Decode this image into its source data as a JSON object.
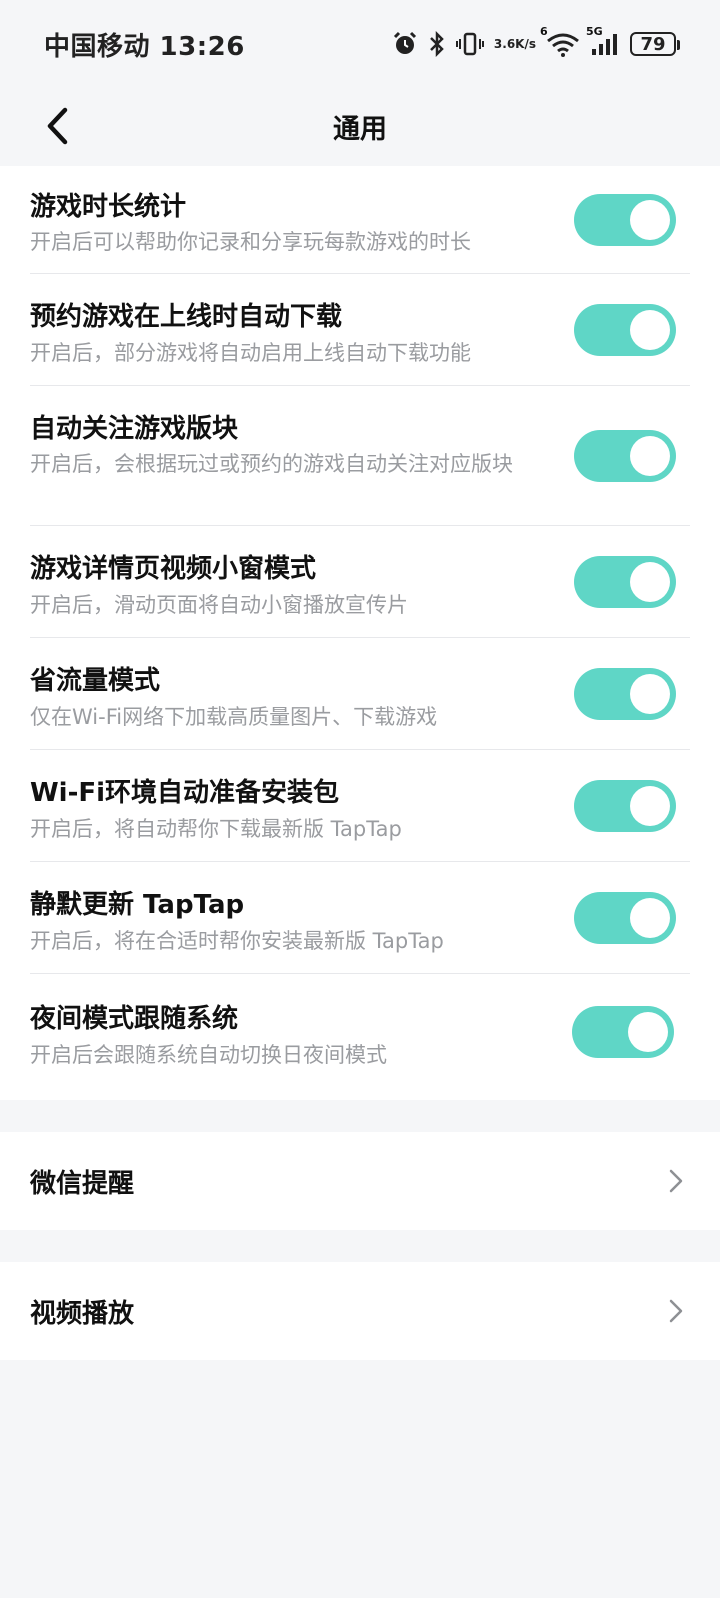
{
  "status_bar": {
    "carrier_time": "中国移动 13:26",
    "net_speed_top": "3.6",
    "net_speed_bottom": "K/s",
    "signal_5g": "5G",
    "wifi_badge": "6",
    "battery": "79"
  },
  "header": {
    "title": "通用"
  },
  "settings": [
    {
      "title": "游戏时长统计",
      "desc": "开启后可以帮助你记录和分享玩每款游戏的时长",
      "on": true
    },
    {
      "title": "预约游戏在上线时自动下载",
      "desc": "开启后，部分游戏将自动启用上线自动下载功能",
      "on": true
    },
    {
      "title": "自动关注游戏版块",
      "desc": "开启后，会根据玩过或预约的游戏自动关注对应版块",
      "on": true
    },
    {
      "title": "游戏详情页视频小窗模式",
      "desc": "开启后，滑动页面将自动小窗播放宣传片",
      "on": true
    },
    {
      "title": "省流量模式",
      "desc": "仅在Wi-Fi网络下加载高质量图片、下载游戏",
      "on": true
    },
    {
      "title": "Wi-Fi环境自动准备安装包",
      "desc": "开启后，将自动帮你下载最新版 TapTap",
      "on": true
    },
    {
      "title": "静默更新 TapTap",
      "desc": "开启后，将在合适时帮你安装最新版 TapTap",
      "on": true
    },
    {
      "title": "夜间模式跟随系统",
      "desc": "开启后会跟随系统自动切换日夜间模式",
      "on": true
    }
  ],
  "nav": {
    "wechat": "微信提醒",
    "video": "视频播放"
  },
  "colors": {
    "toggle_on": "#5fd6c6",
    "background": "#f5f6f8"
  }
}
